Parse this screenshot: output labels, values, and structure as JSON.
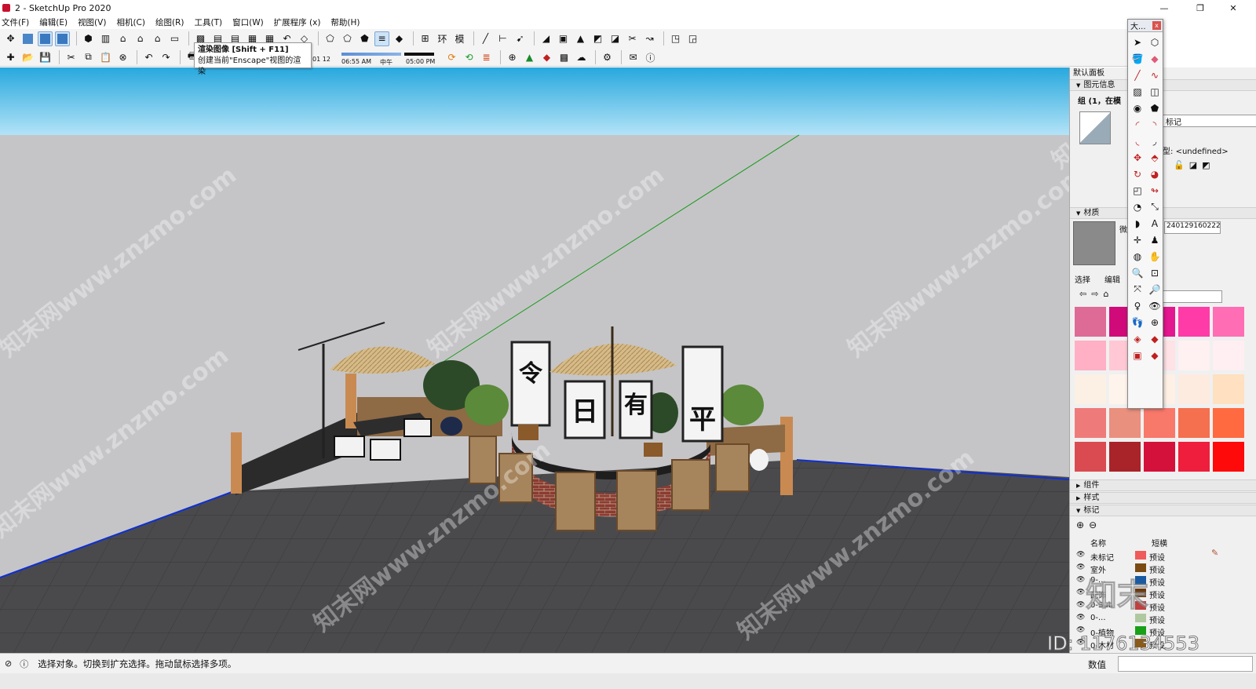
{
  "window": {
    "title": "2 - SketchUp Pro 2020",
    "restore_glyph": "❐"
  },
  "menu": [
    "文件(F)",
    "编辑(E)",
    "视图(V)",
    "相机(C)",
    "绘图(R)",
    "工具(T)",
    "窗口(W)",
    "扩展程序 (x)",
    "帮助(H)"
  ],
  "tooltip": {
    "title": "渲染图像 [Shift + F11]",
    "desc": "创建当前\"Enscape\"视图的渲染"
  },
  "shadow": {
    "time_left": "06:55 AM",
    "time_mid": "中午",
    "time_right": "05:00 PM",
    "date_fragment": "01 12"
  },
  "floating_toolbar": {
    "title": "大...",
    "close": "x"
  },
  "right_panel": {
    "tray_title": "默认面板",
    "entity_info": {
      "header": "图元信息",
      "name": "组 (1，在模",
      "tag": "标记",
      "type_label": "型:",
      "type_value": "<undefined>"
    },
    "materials": {
      "header": "材质",
      "name_prefix": "微",
      "name": "240129160222",
      "tab_select": "选择",
      "tab_edit": "编辑"
    },
    "components": "组件",
    "styles": "样式",
    "tags": {
      "header": "标记",
      "col_name": "名称",
      "col_dash": "短横"
    },
    "layers": [
      {
        "name": "未标记",
        "dash": "预设",
        "color": "#f05a5a"
      },
      {
        "name": "室外",
        "dash": "预设",
        "color": "#7a4a12"
      },
      {
        "name": "0-...",
        "dash": "预设",
        "color": "#1a5aa0"
      },
      {
        "name": "配饰",
        "dash": "预设",
        "color": "#6a3a10"
      },
      {
        "name": "0-Sub",
        "dash": "预设",
        "color": "#c04040"
      },
      {
        "name": "0-...",
        "dash": "预设",
        "color": "#b0c8a0"
      },
      {
        "name": "0-植物",
        "dash": "预设",
        "color": "#18a018"
      },
      {
        "name": "0-木材",
        "dash": "预设",
        "color": "#8a5a1a"
      }
    ]
  },
  "swatches": [
    "#de6b96",
    "#d10a7a",
    "#e3178f",
    "#ff3ba8",
    "#ff6eb4",
    "#ffb0c4",
    "#ffc8d4",
    "#ffe2e6",
    "#fff0f2",
    "#ffeef2",
    "#fcefe4",
    "#fff4ec",
    "#fff0e6",
    "#fdebe0",
    "#ffe0c0",
    "#ef7a7a",
    "#e9907e",
    "#f8786a",
    "#f4704e",
    "#ff6a40",
    "#d94b50",
    "#a82428",
    "#d4113a",
    "#ee1e3c",
    "#ff0a0a"
  ],
  "status": {
    "text": "选择对象。切换到扩充选择。拖动鼠标选择多项。",
    "measure_label": "数值"
  },
  "scene": {
    "sign_left": "令",
    "sign_mid": "日",
    "sign_mid_right": "有",
    "sign_right": "平",
    "watermarks": [
      "知末网www.znzmo.com",
      "知末网www.znzmo.com",
      "知末网www.znzmo.com",
      "知末网www.znzmo.com",
      "知末网www.znzmo.com",
      "知末网www.znzmo.com",
      "知末网www.znzmo.com"
    ],
    "logo_text": "知末",
    "id_text": "ID: 1176134553"
  }
}
